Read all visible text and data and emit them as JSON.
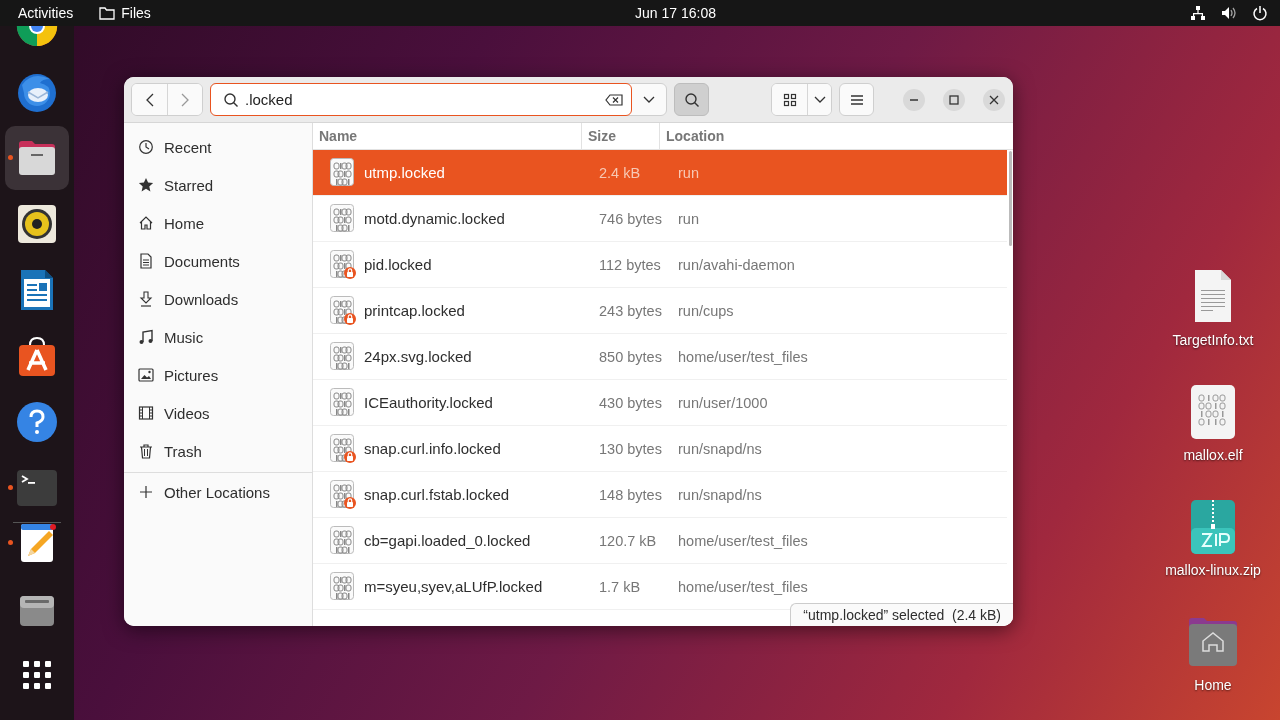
{
  "top_bar": {
    "activities": "Activities",
    "app_menu": "Files",
    "clock": "Jun 17  16:08"
  },
  "dock": [
    {
      "kind": "browser",
      "running": false,
      "selected": false
    },
    {
      "kind": "mail",
      "running": false,
      "selected": false
    },
    {
      "kind": "files",
      "running": true,
      "selected": true
    },
    {
      "kind": "speaker",
      "running": false,
      "selected": false
    },
    {
      "kind": "writer",
      "running": false,
      "selected": false
    },
    {
      "kind": "store",
      "running": false,
      "selected": false
    },
    {
      "kind": "help",
      "running": false,
      "selected": false
    },
    {
      "kind": "terminal",
      "running": true,
      "selected": false
    },
    {
      "kind": "separator"
    },
    {
      "kind": "editor",
      "running": true,
      "selected": false
    },
    {
      "kind": "disk",
      "running": false,
      "selected": false
    },
    {
      "kind": "apps",
      "running": false,
      "selected": false
    }
  ],
  "window": {
    "search": {
      "value": ".locked"
    },
    "search_toggle": {
      "on": true
    },
    "sidebar": {
      "items": [
        {
          "kind": "recent",
          "label": "Recent"
        },
        {
          "kind": "starred",
          "label": "Starred"
        },
        {
          "kind": "home",
          "label": "Home"
        },
        {
          "kind": "documents",
          "label": "Documents"
        },
        {
          "kind": "downloads",
          "label": "Downloads"
        },
        {
          "kind": "music",
          "label": "Music"
        },
        {
          "kind": "pictures",
          "label": "Pictures"
        },
        {
          "kind": "videos",
          "label": "Videos"
        },
        {
          "kind": "trash",
          "label": "Trash"
        }
      ],
      "other_locations": "Other Locations"
    },
    "table": {
      "columns": [
        "Name",
        "Size",
        "Location"
      ],
      "rows": [
        {
          "name": "utmp.locked",
          "size": "2.4 kB",
          "location": "run",
          "locked": false,
          "selected": true
        },
        {
          "name": "motd.dynamic.locked",
          "size": "746 bytes",
          "location": "run",
          "locked": false,
          "selected": false
        },
        {
          "name": "pid.locked",
          "size": "112 bytes",
          "location": "run/avahi-daemon",
          "locked": true,
          "selected": false
        },
        {
          "name": "printcap.locked",
          "size": "243 bytes",
          "location": "run/cups",
          "locked": true,
          "selected": false
        },
        {
          "name": "24px.svg.locked",
          "size": "850 bytes",
          "location": "home/user/test_files",
          "locked": false,
          "selected": false
        },
        {
          "name": "ICEauthority.locked",
          "size": "430 bytes",
          "location": "run/user/1000",
          "locked": false,
          "selected": false
        },
        {
          "name": "snap.curl.info.locked",
          "size": "130 bytes",
          "location": "run/snapd/ns",
          "locked": true,
          "selected": false
        },
        {
          "name": "snap.curl.fstab.locked",
          "size": "148 bytes",
          "location": "run/snapd/ns",
          "locked": true,
          "selected": false
        },
        {
          "name": "cb=gapi.loaded_0.locked",
          "size": "120.7 kB",
          "location": "home/user/test_files",
          "locked": false,
          "selected": false
        },
        {
          "name": "m=syeu,syev,aLUfP.locked",
          "size": "1.7 kB",
          "location": "home/user/test_files",
          "locked": false,
          "selected": false
        }
      ]
    },
    "status": "“utmp.locked” selected  (2.4 kB)"
  },
  "desktop_icons": [
    {
      "kind": "text",
      "label": "TargetInfo.txt"
    },
    {
      "kind": "binary",
      "label": "mallox.elf"
    },
    {
      "kind": "zip",
      "label": "mallox-linux.zip"
    },
    {
      "kind": "home",
      "label": "Home"
    }
  ]
}
